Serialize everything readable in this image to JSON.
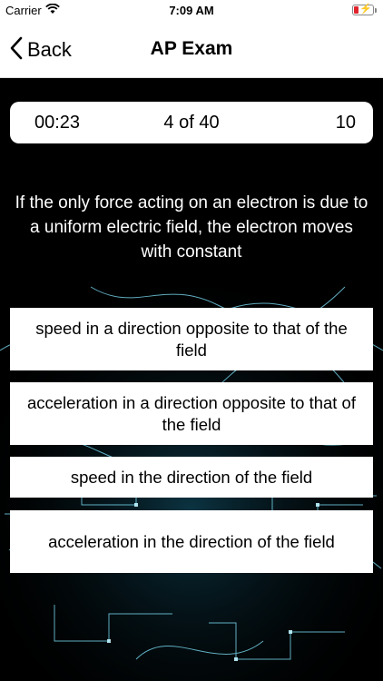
{
  "status_bar": {
    "carrier": "Carrier",
    "time": "7:09 AM",
    "icons": [
      "wifi-icon",
      "battery-charging-icon"
    ]
  },
  "nav": {
    "back_label": "Back",
    "title": "AP Exam"
  },
  "scoreboard": {
    "timer": "00:23",
    "progress": "4 of 40",
    "score": "10"
  },
  "question": {
    "text": "If the only force acting on an electron is due to a uniform electric field, the electron moves with constant"
  },
  "answers": [
    "speed in a direction opposite to that of the field",
    "acceleration in a direction opposite to that of the field",
    "speed in the direction of the field",
    "acceleration in the direction of the field"
  ],
  "colors": {
    "background": "#000000",
    "card": "#ffffff",
    "glow": "#7fe6ff",
    "battery_low": "#e0242c"
  }
}
